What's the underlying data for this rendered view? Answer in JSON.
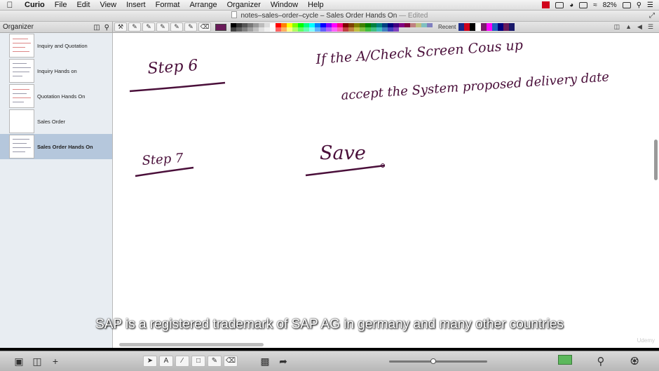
{
  "menubar": {
    "app": "Curio",
    "menus": [
      "File",
      "Edit",
      "View",
      "Insert",
      "Format",
      "Arrange",
      "Organizer",
      "Window",
      "Help"
    ],
    "battery": "82%"
  },
  "window": {
    "title": "notes–sales–order–cycle – Sales Order Hands On",
    "edited": "— Edited"
  },
  "toolbar": {
    "organizer_label": "Organizer",
    "recent_label": "Recent",
    "selected_color": "#6a1a5a",
    "palette": [
      "#000000",
      "#333333",
      "#555555",
      "#777777",
      "#999999",
      "#bbbbbb",
      "#dddddd",
      "#ffffff",
      "#ff0000",
      "#ff8000",
      "#ffff00",
      "#80ff00",
      "#00ff00",
      "#00ff80",
      "#00ffff",
      "#0080ff",
      "#0000ff",
      "#8000ff",
      "#ff00ff",
      "#ff0080",
      "#800000",
      "#804000",
      "#808000",
      "#408000",
      "#008000",
      "#008040",
      "#008080",
      "#004080",
      "#000080",
      "#400080",
      "#800080",
      "#800040",
      "#c08080",
      "#c0c080",
      "#80c0c0",
      "#8080c0",
      "#404040",
      "#606060",
      "#808080",
      "#a0a0a0",
      "#c0c0c0",
      "#e0e0e0",
      "#f0f0f0",
      "#fafafa",
      "#ff6060",
      "#ffb060",
      "#ffff80",
      "#b0ff60",
      "#60ff60",
      "#60ffb0",
      "#80ffff",
      "#60b0ff",
      "#6060ff",
      "#b060ff",
      "#ff60ff",
      "#ff60b0",
      "#c04040",
      "#c08040",
      "#c0c040",
      "#80c040",
      "#40c040",
      "#40c080",
      "#40c0c0",
      "#4080c0",
      "#4040c0",
      "#8040c0"
    ],
    "recent": [
      "#1a2a8a",
      "#d0021b",
      "#000000",
      "#ffffff",
      "#7a1a6a",
      "#ff00ff",
      "#2060c0",
      "#000080",
      "#6a1a5a",
      "#1a1a6a"
    ]
  },
  "sidebar": {
    "pages": [
      {
        "label": "Inquiry and Quotation",
        "active": false
      },
      {
        "label": "Inquiry Hands on",
        "active": false
      },
      {
        "label": "Quotation Hands On",
        "active": false
      },
      {
        "label": "Sales Order",
        "active": false
      },
      {
        "label": "Sales Order Hands On",
        "active": true
      }
    ]
  },
  "canvas": {
    "step6": "Step 6",
    "note_line1": "If the A/Check Screen Cous up",
    "note_line2": "accept the System proposed delivery date",
    "step7": "Step 7",
    "save": "Save",
    "ink_color": "#4a0f3a",
    "watermark": "Udemy"
  },
  "subtitle": "SAP is a registered trademark of SAP AG in germany and many other countries",
  "bottombar": {
    "zoom_fraction": 0.42
  }
}
